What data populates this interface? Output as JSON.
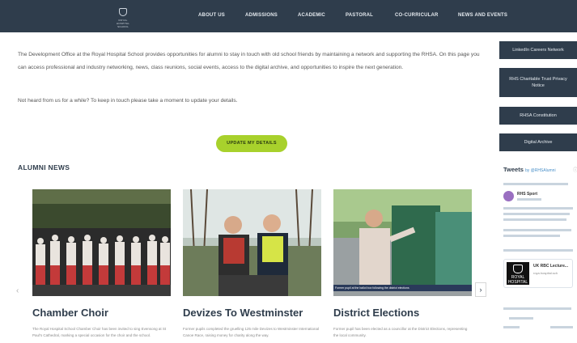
{
  "header": {
    "logo_text": "ROYAL HOSPITAL SCHOOL",
    "nav": [
      {
        "label": "ABOUT US"
      },
      {
        "label": "ADMISSIONS"
      },
      {
        "label": "ACADEMIC"
      },
      {
        "label": "PASTORAL"
      },
      {
        "label": "CO-CURRICULAR"
      },
      {
        "label": "NEWS AND EVENTS"
      }
    ]
  },
  "intro": {
    "paragraph": "The Development Office at the Royal Hospital School provides opportunities for alumni to stay in touch with old school friends by maintaining a network and supporting the RHSA. On this page you can access professional and industry networking, news, class reunions, social events, access to the digital archive, and opportunities to inspire the next generation.",
    "prompt": "Not heard from us for a while? To keep in touch please take a moment to update your details.",
    "update_button": "UPDATE MY DETAILS"
  },
  "alumni_news": {
    "heading": "ALUMNI NEWS",
    "cards": [
      {
        "title": "Chamber Choir",
        "excerpt": "The Royal Hospital School Chamber Choir has been invited to sing Evensong at St Paul's Cathedral, marking a special occasion for the choir and the school."
      },
      {
        "title": "Devizes To Westminster",
        "excerpt": "Former pupils completed the gruelling 125 mile Devizes to Westminster International Canoe Race, raising money for charity along the way."
      },
      {
        "title": "District Elections",
        "excerpt": "Former pupil has been elected as a councillor at the District Elections, representing the local community.",
        "caption": "Former pupil at the ballot box following the district elections"
      }
    ],
    "prev_arrow": "‹",
    "next_arrow": "›"
  },
  "sidebar": {
    "buttons": [
      {
        "label": "LinkedIn Careers Network"
      },
      {
        "label": "RHS Charitable Trust Privacy Notice"
      },
      {
        "label": "RHSA Constitution"
      },
      {
        "label": "Digital Archive"
      }
    ],
    "tweets": {
      "title": "Tweets",
      "by": "by @RHSAlumni",
      "author_name": "RHS Sport",
      "card_title": "UK RBC Lecture...",
      "card_source": "roya.hospital.sch",
      "card_logo_text": "ROYAL HOSPITAL"
    }
  },
  "colors": {
    "header_bg": "#2f3d4c",
    "accent_green": "#a8d12c",
    "sidebar_button_bg": "#2f3d4c",
    "heading_navy": "#2f3d4c"
  }
}
